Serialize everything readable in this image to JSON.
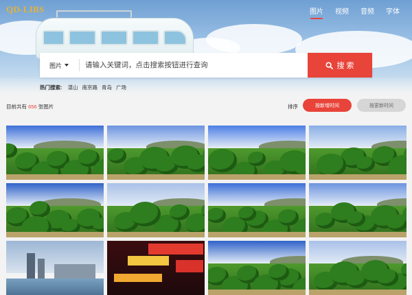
{
  "brand": {
    "logo": "QD-LIBS",
    "accent": "#e8443a",
    "logo_color": "#e3b23a"
  },
  "nav": [
    {
      "label": "图片",
      "active": true
    },
    {
      "label": "视频",
      "active": false
    },
    {
      "label": "音频",
      "active": false
    },
    {
      "label": "字体",
      "active": false
    }
  ],
  "search": {
    "category": "图片",
    "placeholder": "请输入关键词，点击搜索按钮进行查询",
    "value": "",
    "button_label": "搜 索",
    "button_icon": "search-icon"
  },
  "hot_search": {
    "label": "热门搜索:",
    "tags": [
      "湛山",
      "南京路",
      "青岛",
      "广场"
    ]
  },
  "results": {
    "prefix": "目前共有",
    "count": "656",
    "suffix": "张图片"
  },
  "sort": {
    "label": "排序",
    "options": [
      {
        "label": "按新增时间",
        "active": true
      },
      {
        "label": "按更新时间",
        "active": false
      }
    ]
  },
  "gallery": [
    {
      "scene": "orchard"
    },
    {
      "scene": "orchard"
    },
    {
      "scene": "orchard"
    },
    {
      "scene": "orchard"
    },
    {
      "scene": "orchard"
    },
    {
      "scene": "orchard"
    },
    {
      "scene": "orchard"
    },
    {
      "scene": "orchard"
    },
    {
      "scene": "city"
    },
    {
      "scene": "street"
    },
    {
      "scene": "orchard"
    },
    {
      "scene": "orchard"
    }
  ]
}
